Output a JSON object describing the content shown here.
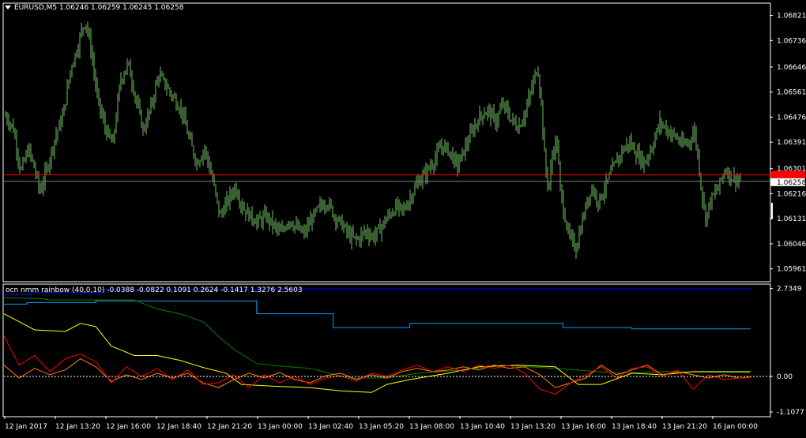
{
  "main_panel": {
    "symbol_menu_icon": "triangle-down-icon",
    "header": "EURUSD,M5  1.06246 1.06259 1.06245 1.06258",
    "bid_line_value": "1.06258"
  },
  "indicator_panel": {
    "header": "ocn nmm rainbow  (40,0,10) -0.0388 -0.0822 0.1091 0.2624 -0.1417 1.3276 2.5603"
  },
  "colors": {
    "background": "#000000",
    "grid_border": "#ffffff",
    "candles": "#6fbf60",
    "ask_line": "#ff0000",
    "bid_line": "#808080",
    "bid_label_bg": "#ffffff",
    "ask_label_bg": "#ff0000",
    "series": [
      "#0000ff",
      "#00a0ff",
      "#008000",
      "#ffff00",
      "#ff8000",
      "#ff0000"
    ]
  },
  "chart_data": [
    {
      "type": "bar",
      "subtype": "ohlc",
      "title": "EURUSD,M5",
      "ylim": [
        1.0592,
        1.0686
      ],
      "y_ticks": [
        "1.06821",
        "1.06736",
        "1.06646",
        "1.06561",
        "1.06476",
        "1.06391",
        "1.06301",
        "1.06216",
        "1.06131",
        "1.06046",
        "1.05961"
      ],
      "bid": 1.06258,
      "ask": 1.0628,
      "close_path": [
        [
          0.0,
          1.0648
        ],
        [
          0.01,
          1.0644
        ],
        [
          0.02,
          1.0629
        ],
        [
          0.03,
          1.0637
        ],
        [
          0.04,
          1.0628
        ],
        [
          0.045,
          1.0622
        ],
        [
          0.055,
          1.0631
        ],
        [
          0.065,
          1.0641
        ],
        [
          0.075,
          1.0648
        ],
        [
          0.085,
          1.0664
        ],
        [
          0.095,
          1.0672
        ],
        [
          0.1,
          1.0678
        ],
        [
          0.105,
          1.068
        ],
        [
          0.112,
          1.067
        ],
        [
          0.12,
          1.0654
        ],
        [
          0.13,
          1.0644
        ],
        [
          0.14,
          1.0638
        ],
        [
          0.15,
          1.066
        ],
        [
          0.16,
          1.0666
        ],
        [
          0.17,
          1.0654
        ],
        [
          0.18,
          1.0643
        ],
        [
          0.19,
          1.0651
        ],
        [
          0.2,
          1.0662
        ],
        [
          0.21,
          1.0658
        ],
        [
          0.22,
          1.0654
        ],
        [
          0.23,
          1.065
        ],
        [
          0.24,
          1.064
        ],
        [
          0.25,
          1.0632
        ],
        [
          0.26,
          1.0637
        ],
        [
          0.27,
          1.0627
        ],
        [
          0.28,
          1.0614
        ],
        [
          0.29,
          1.0619
        ],
        [
          0.3,
          1.0624
        ],
        [
          0.31,
          1.0617
        ],
        [
          0.32,
          1.0614
        ],
        [
          0.33,
          1.0612
        ],
        [
          0.34,
          1.0614
        ],
        [
          0.35,
          1.0611
        ],
        [
          0.36,
          1.0608
        ],
        [
          0.37,
          1.0613
        ],
        [
          0.38,
          1.061
        ],
        [
          0.39,
          1.0608
        ],
        [
          0.4,
          1.0613
        ],
        [
          0.41,
          1.0617
        ],
        [
          0.42,
          1.0619
        ],
        [
          0.43,
          1.0614
        ],
        [
          0.44,
          1.0611
        ],
        [
          0.45,
          1.0607
        ],
        [
          0.46,
          1.0606
        ],
        [
          0.47,
          1.0609
        ],
        [
          0.48,
          1.0607
        ],
        [
          0.49,
          1.061
        ],
        [
          0.5,
          1.0614
        ],
        [
          0.51,
          1.0617
        ],
        [
          0.52,
          1.0616
        ],
        [
          0.53,
          1.0621
        ],
        [
          0.54,
          1.0626
        ],
        [
          0.55,
          1.0629
        ],
        [
          0.56,
          1.0633
        ],
        [
          0.57,
          1.0638
        ],
        [
          0.58,
          1.0636
        ],
        [
          0.59,
          1.0631
        ],
        [
          0.6,
          1.0637
        ],
        [
          0.61,
          1.0643
        ],
        [
          0.62,
          1.0648
        ],
        [
          0.63,
          1.065
        ],
        [
          0.64,
          1.0646
        ],
        [
          0.65,
          1.0652
        ],
        [
          0.66,
          1.0647
        ],
        [
          0.67,
          1.0644
        ],
        [
          0.68,
          1.065
        ],
        [
          0.69,
          1.066
        ],
        [
          0.695,
          1.0665
        ],
        [
          0.7,
          1.0652
        ],
        [
          0.705,
          1.063
        ],
        [
          0.71,
          1.0624
        ],
        [
          0.715,
          1.0636
        ],
        [
          0.72,
          1.064
        ],
        [
          0.725,
          1.0622
        ],
        [
          0.735,
          1.0608
        ],
        [
          0.745,
          1.0603
        ],
        [
          0.755,
          1.0614
        ],
        [
          0.765,
          1.0624
        ],
        [
          0.775,
          1.0619
        ],
        [
          0.785,
          1.0625
        ],
        [
          0.795,
          1.0631
        ],
        [
          0.805,
          1.0636
        ],
        [
          0.815,
          1.0639
        ],
        [
          0.825,
          1.0635
        ],
        [
          0.835,
          1.0632
        ],
        [
          0.845,
          1.0638
        ],
        [
          0.855,
          1.0646
        ],
        [
          0.865,
          1.0643
        ],
        [
          0.875,
          1.0641
        ],
        [
          0.885,
          1.0638
        ],
        [
          0.895,
          1.064
        ],
        [
          0.9,
          1.0643
        ],
        [
          0.905,
          1.0633
        ],
        [
          0.91,
          1.0621
        ],
        [
          0.915,
          1.0613
        ],
        [
          0.92,
          1.0619
        ],
        [
          0.93,
          1.0623
        ],
        [
          0.94,
          1.063
        ],
        [
          0.95,
          1.0627
        ],
        [
          0.96,
          1.0626
        ]
      ]
    },
    {
      "type": "line",
      "title": "ocn nmm rainbow  (40,0,10)",
      "ylim": [
        -1.23,
        2.85
      ],
      "y_ticks": [
        "2.7349",
        "0.00",
        "-1.1077"
      ],
      "zero_line": 0,
      "x_tick_labels": [
        "12 Jan 2017",
        "12 Jan 13:20",
        "12 Jan 16:00",
        "12 Jan 18:40",
        "12 Jan 21:20",
        "13 Jan 00:00",
        "13 Jan 02:40",
        "13 Jan 05:20",
        "13 Jan 08:00",
        "13 Jan 10:40",
        "13 Jan 13:20",
        "13 Jan 16:00",
        "13 Jan 18:40",
        "13 Jan 21:20",
        "16 Jan 00:00"
      ],
      "series": [
        {
          "color": "#0000ff",
          "points": [
            [
              0.0,
              2.55
            ],
            [
              0.035,
              2.55
            ],
            [
              0.035,
              2.62
            ],
            [
              0.13,
              2.62
            ],
            [
              0.13,
              2.7
            ],
            [
              0.33,
              2.7
            ],
            [
              0.33,
              2.73
            ],
            [
              0.975,
              2.73
            ]
          ]
        },
        {
          "color": "#00a0ff",
          "points": [
            [
              0.0,
              2.25
            ],
            [
              0.03,
              2.25
            ],
            [
              0.03,
              2.3
            ],
            [
              0.12,
              2.3
            ],
            [
              0.12,
              2.35
            ],
            [
              0.33,
              2.35
            ],
            [
              0.33,
              1.95
            ],
            [
              0.43,
              1.95
            ],
            [
              0.43,
              1.52
            ],
            [
              0.53,
              1.52
            ],
            [
              0.53,
              1.65
            ],
            [
              0.73,
              1.65
            ],
            [
              0.73,
              1.52
            ],
            [
              0.82,
              1.52
            ],
            [
              0.82,
              1.48
            ],
            [
              0.975,
              1.48
            ]
          ]
        },
        {
          "color": "#008000",
          "points": [
            [
              0.0,
              2.45
            ],
            [
              0.05,
              2.42
            ],
            [
              0.06,
              2.38
            ],
            [
              0.17,
              2.38
            ],
            [
              0.2,
              2.1
            ],
            [
              0.23,
              1.95
            ],
            [
              0.26,
              1.7
            ],
            [
              0.28,
              1.25
            ],
            [
              0.3,
              0.85
            ],
            [
              0.33,
              0.4
            ],
            [
              0.36,
              0.32
            ],
            [
              0.4,
              0.25
            ],
            [
              0.45,
              -0.05
            ],
            [
              0.5,
              -0.05
            ],
            [
              0.54,
              0.1
            ],
            [
              0.6,
              0.2
            ],
            [
              0.65,
              0.35
            ],
            [
              0.72,
              0.25
            ],
            [
              0.8,
              0.1
            ],
            [
              0.86,
              0.15
            ],
            [
              0.975,
              0.12
            ]
          ]
        },
        {
          "color": "#ffff00",
          "points": [
            [
              0.0,
              1.95
            ],
            [
              0.04,
              1.45
            ],
            [
              0.08,
              1.4
            ],
            [
              0.1,
              1.65
            ],
            [
              0.12,
              1.55
            ],
            [
              0.14,
              0.95
            ],
            [
              0.17,
              0.65
            ],
            [
              0.2,
              0.65
            ],
            [
              0.23,
              0.5
            ],
            [
              0.26,
              0.28
            ],
            [
              0.29,
              0.1
            ],
            [
              0.31,
              -0.25
            ],
            [
              0.35,
              -0.3
            ],
            [
              0.4,
              -0.35
            ],
            [
              0.44,
              -0.45
            ],
            [
              0.48,
              -0.5
            ],
            [
              0.5,
              -0.25
            ],
            [
              0.53,
              -0.1
            ],
            [
              0.58,
              0.1
            ],
            [
              0.62,
              0.3
            ],
            [
              0.67,
              0.35
            ],
            [
              0.72,
              0.3
            ],
            [
              0.75,
              -0.25
            ],
            [
              0.78,
              -0.25
            ],
            [
              0.82,
              0.1
            ],
            [
              0.86,
              0.05
            ],
            [
              0.9,
              0.15
            ],
            [
              0.975,
              0.15
            ]
          ]
        },
        {
          "color": "#ff8000",
          "points": [
            [
              0.0,
              0.35
            ],
            [
              0.02,
              -0.05
            ],
            [
              0.04,
              0.25
            ],
            [
              0.06,
              0.05
            ],
            [
              0.08,
              0.2
            ],
            [
              0.1,
              0.55
            ],
            [
              0.12,
              0.3
            ],
            [
              0.14,
              -0.15
            ],
            [
              0.16,
              0.05
            ],
            [
              0.18,
              -0.1
            ],
            [
              0.2,
              0.1
            ],
            [
              0.22,
              -0.05
            ],
            [
              0.24,
              0.1
            ],
            [
              0.26,
              -0.2
            ],
            [
              0.28,
              -0.35
            ],
            [
              0.3,
              -0.1
            ],
            [
              0.32,
              0.1
            ],
            [
              0.34,
              -0.05
            ],
            [
              0.36,
              0.12
            ],
            [
              0.38,
              -0.1
            ],
            [
              0.4,
              -0.2
            ],
            [
              0.42,
              0.02
            ],
            [
              0.44,
              0.1
            ],
            [
              0.46,
              -0.1
            ],
            [
              0.48,
              0.05
            ],
            [
              0.5,
              -0.05
            ],
            [
              0.52,
              0.15
            ],
            [
              0.54,
              0.25
            ],
            [
              0.56,
              0.15
            ],
            [
              0.58,
              0.2
            ],
            [
              0.6,
              0.3
            ],
            [
              0.62,
              0.2
            ],
            [
              0.64,
              0.35
            ],
            [
              0.66,
              0.25
            ],
            [
              0.68,
              0.3
            ],
            [
              0.7,
              0.05
            ],
            [
              0.72,
              -0.35
            ],
            [
              0.74,
              -0.2
            ],
            [
              0.76,
              -0.05
            ],
            [
              0.78,
              0.35
            ],
            [
              0.8,
              0.05
            ],
            [
              0.82,
              0.2
            ],
            [
              0.84,
              0.35
            ],
            [
              0.86,
              0.05
            ],
            [
              0.88,
              0.15
            ],
            [
              0.9,
              0.05
            ],
            [
              0.92,
              -0.05
            ],
            [
              0.94,
              0.05
            ],
            [
              0.96,
              -0.05
            ],
            [
              0.975,
              -0.02
            ]
          ]
        },
        {
          "color": "#ff0000",
          "points": [
            [
              0.0,
              1.25
            ],
            [
              0.02,
              0.35
            ],
            [
              0.04,
              0.65
            ],
            [
              0.06,
              0.15
            ],
            [
              0.08,
              0.55
            ],
            [
              0.1,
              0.7
            ],
            [
              0.12,
              0.45
            ],
            [
              0.14,
              -0.2
            ],
            [
              0.16,
              0.3
            ],
            [
              0.18,
              0.0
            ],
            [
              0.2,
              0.25
            ],
            [
              0.22,
              -0.1
            ],
            [
              0.24,
              0.2
            ],
            [
              0.26,
              -0.25
            ],
            [
              0.28,
              -0.2
            ],
            [
              0.3,
              0.05
            ],
            [
              0.32,
              -0.35
            ],
            [
              0.34,
              0.05
            ],
            [
              0.36,
              -0.2
            ],
            [
              0.38,
              0.0
            ],
            [
              0.4,
              -0.25
            ],
            [
              0.42,
              -0.05
            ],
            [
              0.44,
              0.02
            ],
            [
              0.46,
              -0.15
            ],
            [
              0.48,
              0.1
            ],
            [
              0.5,
              0.0
            ],
            [
              0.52,
              0.2
            ],
            [
              0.54,
              0.35
            ],
            [
              0.56,
              0.15
            ],
            [
              0.58,
              0.3
            ],
            [
              0.6,
              0.15
            ],
            [
              0.62,
              0.35
            ],
            [
              0.64,
              0.25
            ],
            [
              0.66,
              0.35
            ],
            [
              0.68,
              0.1
            ],
            [
              0.7,
              -0.4
            ],
            [
              0.72,
              -0.55
            ],
            [
              0.74,
              -0.2
            ],
            [
              0.76,
              0.05
            ],
            [
              0.78,
              0.3
            ],
            [
              0.8,
              -0.05
            ],
            [
              0.82,
              0.25
            ],
            [
              0.84,
              0.3
            ],
            [
              0.86,
              0.0
            ],
            [
              0.88,
              0.2
            ],
            [
              0.9,
              -0.4
            ],
            [
              0.92,
              0.05
            ],
            [
              0.94,
              -0.1
            ],
            [
              0.96,
              -0.05
            ],
            [
              0.975,
              -0.04
            ]
          ]
        }
      ]
    }
  ]
}
